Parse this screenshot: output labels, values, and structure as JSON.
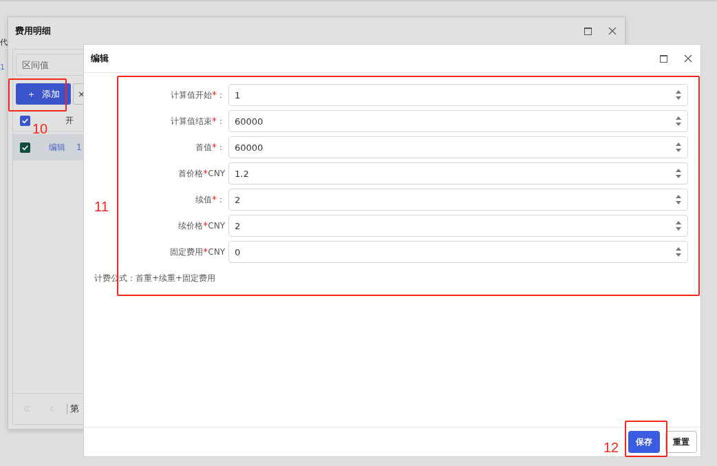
{
  "background_page": {
    "texts": [
      "代",
      "1"
    ]
  },
  "back_window": {
    "title": "费用明细",
    "search": {
      "placeholder": "区间值"
    },
    "toolbar": [
      {
        "kind": "primary",
        "icon": "＋",
        "label": "添加"
      },
      {
        "kind": "plain",
        "icon": "×"
      }
    ],
    "table": {
      "header_checked": true,
      "columns": [
        "开"
      ],
      "rows": [
        {
          "checked": true,
          "action": "编辑",
          "column_2": "1",
          "selected": true
        }
      ]
    },
    "pager": {
      "label": "第"
    }
  },
  "edit_window": {
    "title": "编辑",
    "fields": [
      {
        "label": "计算值开始",
        "required": true,
        "suffix": "：",
        "value": "1"
      },
      {
        "label": "计算值结束",
        "required": true,
        "suffix": "：",
        "value": "60000"
      },
      {
        "label": "首值",
        "required": true,
        "suffix": "：",
        "value": "60000"
      },
      {
        "label": "首价格",
        "required": true,
        "suffix": "CNY",
        "value": "1.2"
      },
      {
        "label": "续值",
        "required": true,
        "suffix": "：",
        "value": "2"
      },
      {
        "label": "续价格",
        "required": true,
        "suffix": "CNY",
        "value": "2"
      },
      {
        "label": "固定费用",
        "required": true,
        "suffix": "CNY",
        "value": "0"
      }
    ],
    "formula": "计费公式：首重+续重+固定费用",
    "buttons": [
      {
        "kind": "primary",
        "label": "保存"
      },
      {
        "kind": "plain",
        "label": "重置"
      }
    ]
  },
  "annotations": [
    {
      "number": "10"
    },
    {
      "number": "11"
    },
    {
      "number": "12"
    }
  ]
}
